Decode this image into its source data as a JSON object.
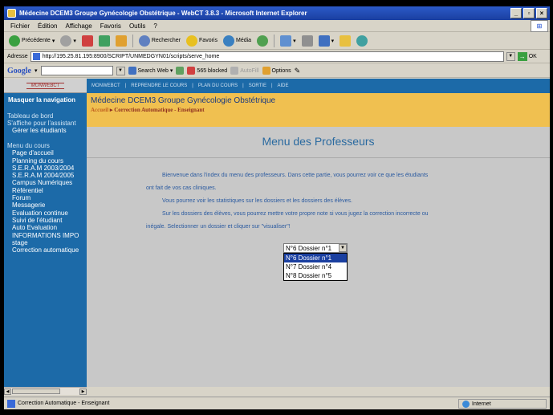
{
  "window": {
    "title": "Médecine DCEM3 Groupe Gynécologie Obstétrique - WebCT 3.8.3 - Microsoft Internet Explorer"
  },
  "menubar": {
    "items": [
      "Fichier",
      "Édition",
      "Affichage",
      "Favoris",
      "Outils",
      "?"
    ]
  },
  "toolbar": {
    "back": "Précédente",
    "search": "Rechercher",
    "favorites": "Favoris",
    "media": "Média"
  },
  "address": {
    "label": "Adresse",
    "url": "http://195.25.81.195:8900/SCRIPT/UNMEDGYN01/scripts/serve_home",
    "go": "OK"
  },
  "google": {
    "logo": "Google",
    "search_web": "Search Web",
    "blocked": "565 blocked",
    "autofill": "AutoFill",
    "options": "Options"
  },
  "sidebar": {
    "logo": "MONWEBCT",
    "hide_nav": "Masquer la navigation",
    "dashboard": "Tableau de bord",
    "dash_items": [
      "S'affiche pour l'assistant",
      "Gérer les étudiants"
    ],
    "course_menu": "Menu du cours",
    "course_items": [
      "Page d'accueil",
      "Planning du cours",
      "S.E.R.A.M 2003/2004",
      "S.E.R.A.M 2004/2005",
      "Campus Numériques",
      "Référentiel",
      "Forum",
      "Messagerie",
      "Evaluation continue",
      "Suivi de l'étudiant",
      "Auto Evaluation",
      "INFORMATIONS IMPO",
      "stage",
      "Correction automatique"
    ]
  },
  "navbar": {
    "items": [
      "MONWEBCT",
      "REPRENDRE LE COURS",
      "PLAN DU COURS",
      "SORTIE",
      "AIDE"
    ]
  },
  "header": {
    "course_title": "Médecine DCEM3 Groupe Gynécologie Obstétrique",
    "breadcrumb_home": "Accueil",
    "breadcrumb_current": "Correction Automatique - Enseignant"
  },
  "main": {
    "heading": "Menu des Professeurs",
    "para1a": "Bienvenue dans l'index du menu des professeurs. Dans cette partie, vous pourrez voir ce que les étudiants",
    "para1b": "ont fait de vos cas cliniques.",
    "para2": "Vous pourrez voir les statistiques sur les dossiers et les dossiers des élèves.",
    "para3a": "Sur les dossiers des élèves, vous pourrez mettre votre propre note si vous jugez la correction incorrecte ou",
    "para3b": "inégale. Selectionner un dossier et cliquer sur \"visualiser\"!",
    "select_value": "N°6 Dossier n°1",
    "options": [
      "N°6 Dossier n°1",
      "N°7 Dossier n°4",
      "N°8 Dossier n°5"
    ]
  },
  "status": {
    "text": "Correction Automatique - Enseignant",
    "zone": "Internet"
  }
}
